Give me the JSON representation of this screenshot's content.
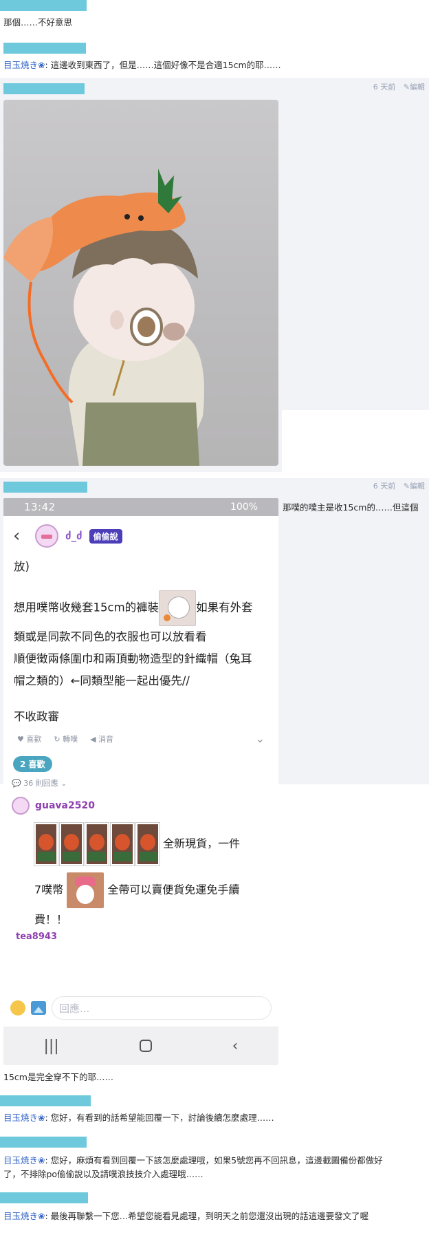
{
  "messages": {
    "m1": {
      "text": "那個……不好意思"
    },
    "m2": {
      "author": "目玉焼き",
      "star": "❀",
      "text": ": 這邊收到東西了，但是……這個好像不是合適15cm的耶……"
    },
    "m3": {
      "time": "6 天前",
      "edit": "編輯"
    },
    "m4": {
      "time": "6 天前",
      "edit": "編輯",
      "side_text": "那噗的噗主是收15cm的……但這個"
    },
    "m5": {
      "text": "15cm是完全穿不下的耶……"
    },
    "m6": {
      "author": "目玉焼き",
      "star": "❀",
      "text": ": 您好，有看到的話希望能回覆一下，討論後續怎麼處理……"
    },
    "m7": {
      "author": "目玉焼き",
      "star": "❀",
      "text1": ": 您好，麻煩有看到回覆一下該怎麼處理哦，如果5號您再不回訊息，這邊截圖備份都做好",
      "text2": "了，不排除po偷偷說以及請噗浪技技介入處理哦……"
    },
    "m8": {
      "author": "目玉焼き",
      "star": "❀",
      "text": ": 最後再聯繫一下您…希望您能看見處理，到明天之前您還沒出現的話這邊要發文了喔"
    }
  },
  "phone": {
    "status_time": "13:42",
    "status_right": "100%",
    "username": "ძ_ძ",
    "badge": "偷偷說",
    "body_l1": "放)",
    "body_l2a": "想用噗幣收幾套15cm的褲裝",
    "body_l2b": "如果有外套",
    "body_l3": "類或是同款不同色的衣服也可以放看看",
    "body_l4": "順便徵兩條圍巾和兩頂動物造型的針織帽（兔耳",
    "body_l5": "帽之類的）←同類型能一起出優先//",
    "body_l6": "不收政審",
    "like_label": "喜歡",
    "replurk_label": "轉噗",
    "mute_label": "消音",
    "likes_pill": "2 喜歡",
    "reply_count": "36 則回應",
    "commenter": "guava2520",
    "comment_l1": "全新現貨，一件",
    "comment_l2a": "7噗幣",
    "comment_l2b": "全帶可以賣便貨免運免手續",
    "comment_l3": "費！！",
    "next_commenter": "tea8943",
    "reply_placeholder": "回應..."
  },
  "colors": {
    "name_bar": "#6ec9dc",
    "author": "#2f62c7",
    "badge": "#4b3eb8",
    "pill": "#4aa6c0"
  }
}
